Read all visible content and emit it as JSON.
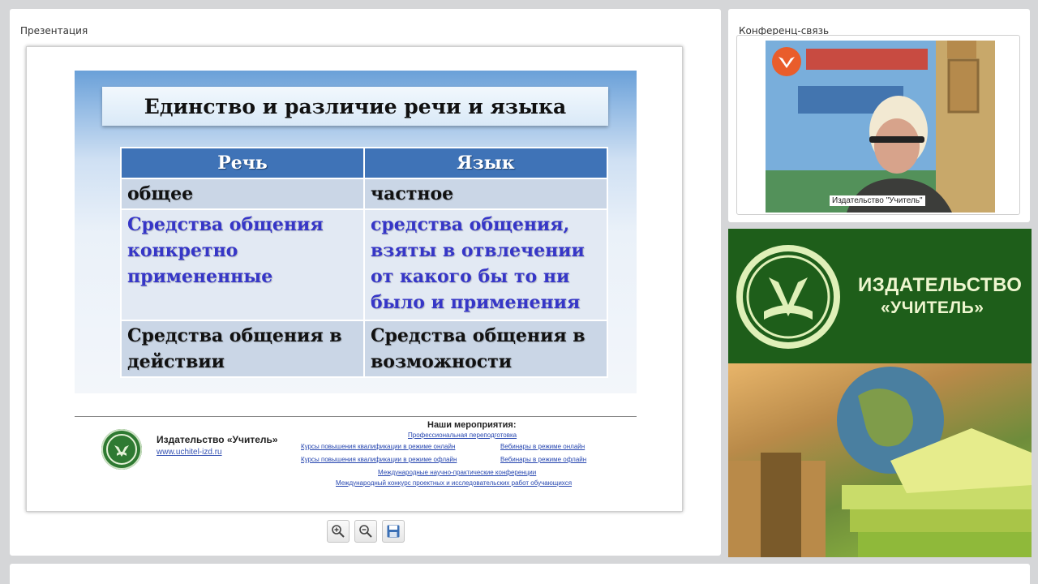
{
  "presentation": {
    "title": "Презентация",
    "slide": {
      "title": "Единство и различие речи и языка",
      "table": {
        "headers": [
          "Речь",
          "Язык"
        ],
        "rows": [
          [
            "общее",
            "частное"
          ],
          [
            "Средства общения конкретно примененные",
            "средства общения, взяты в отвлечении от какого бы то ни было и применения"
          ],
          [
            "Средства общения в действии",
            "Средства общения в возможности"
          ]
        ]
      },
      "footer": {
        "publisher": "Издательство «Учитель»",
        "url": "www.uchitel-izd.ru",
        "events_title": "Наши мероприятия:",
        "links": [
          "Профессиональная переподготовка",
          "Курсы повышения квалификации в режиме онлайн",
          "Вебинары в режиме онлайн",
          "Курсы повышения квалификации в режиме офлайн",
          "Вебинары в режиме офлайн",
          "Международные научно-практические конференции",
          "Международный конкурс проектных и исследовательских работ обучающихся"
        ]
      }
    },
    "toolbar": {
      "zoom_in_icon": "zoom-in-icon",
      "zoom_out_icon": "zoom-out-icon",
      "save_icon": "save-icon"
    }
  },
  "conference": {
    "title": "Конференц-связь",
    "participant_label": "Издательство \"Учитель\""
  },
  "brand": {
    "line1": "ИЗДАТЕЛЬСТВО",
    "line2": "«УЧИТЕЛЬ»"
  }
}
